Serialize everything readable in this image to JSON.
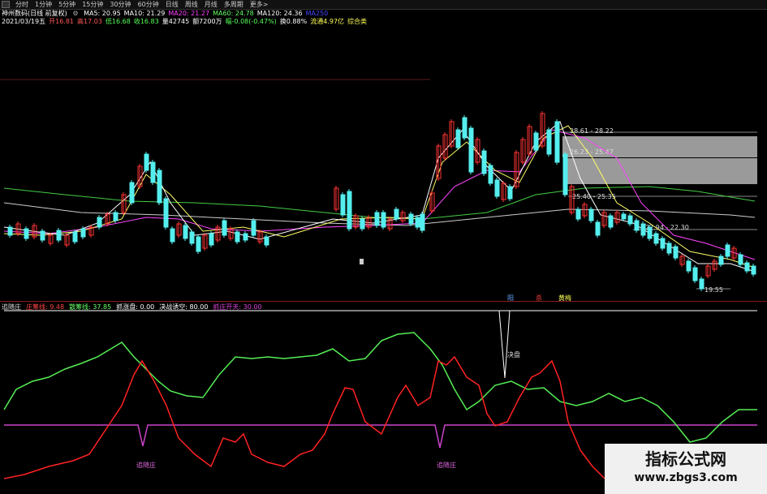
{
  "toolbar": {
    "tabs": [
      "分时",
      "1分钟",
      "5分钟",
      "15分钟",
      "30分钟",
      "60分钟",
      "日线",
      "周线",
      "月线",
      "多周期",
      "更多>"
    ]
  },
  "stock": {
    "name": "神州数码(日线 前复权)",
    "ma_items": [
      {
        "label": "MA5: 20.95",
        "color": "#ffffff"
      },
      {
        "label": "MA10: 21.29",
        "color": "#ffffff"
      },
      {
        "label": "MA20: 21.27",
        "color": "#ff44ff"
      },
      {
        "label": "MA60: 24.78",
        "color": "#66ff66"
      },
      {
        "label": "MA120: 24.36",
        "color": "#ffffff"
      },
      {
        "label": "MA250",
        "color": "#4444ff"
      }
    ],
    "quote_items": [
      {
        "label": "2021/03/19五",
        "color": "#ffffff"
      },
      {
        "label": "开16.81",
        "color": "#ff5555"
      },
      {
        "label": "高17.03",
        "color": "#ff5555"
      },
      {
        "label": "低16.68",
        "color": "#55ff55"
      },
      {
        "label": "收16.83",
        "color": "#55ff55"
      },
      {
        "label": "量42745",
        "color": "#ffffff"
      },
      {
        "label": "额7200万",
        "color": "#ffffff"
      },
      {
        "label": "幅-0.08(-0.47%)",
        "color": "#55ff55"
      },
      {
        "label": "换0.88%",
        "color": "#ffffff"
      },
      {
        "label": "流通4.97亿",
        "color": "#ffff55"
      },
      {
        "label": "综合类",
        "color": "#ffff55"
      }
    ]
  },
  "price_annotations": {
    "box_labels": [
      "28.61 - 28.22",
      "26.23 - 25.47",
      "25.40 - 25.35",
      "22.94 - 22.30"
    ],
    "low_label": "19.55",
    "signal_labels": [
      {
        "text": "阳",
        "color": "#66aaff"
      },
      {
        "text": "杀",
        "color": "#ff4444"
      },
      {
        "text": "黄梅",
        "color": "#ffff55"
      }
    ]
  },
  "indicator": {
    "header": [
      {
        "label": "追随庄",
        "color": "#dddddd"
      },
      {
        "label": "庄筹线: 9.48",
        "color": "#ff4444"
      },
      {
        "label": "散筹线: 37.85",
        "color": "#66ff66"
      },
      {
        "label": "抓涨盘: 0.00",
        "color": "#ffffff"
      },
      {
        "label": "决战诱空: 80.00",
        "color": "#ffffff"
      },
      {
        "label": "抓庄开天: 30.00",
        "color": "#dd44dd"
      }
    ],
    "annotations": [
      "决盘",
      "追随庄",
      "追随庄"
    ]
  },
  "watermark": {
    "line1": "指标公式网",
    "line2": "www.zbgs3.com"
  },
  "colors": {
    "up_candle": "#ff3333",
    "down_candle": "#55eeee",
    "ma5": "#ffffff",
    "ma10": "#ffff66",
    "ma20": "#ff44ff",
    "ma60": "#44cc44",
    "ma120": "#cccccc",
    "zhuang_line": "#ff2222",
    "san_line": "#55ee55",
    "open_line": "#cc44cc"
  }
}
